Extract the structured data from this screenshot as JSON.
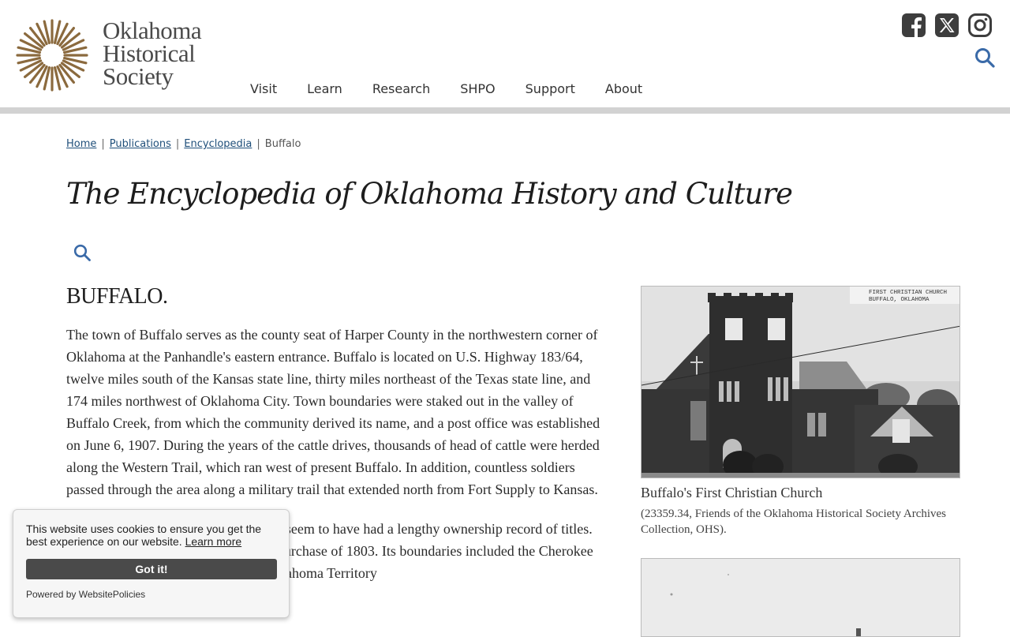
{
  "site": {
    "logo_lines": [
      "Oklahoma",
      "Historical",
      "Society"
    ],
    "nav": [
      "Visit",
      "Learn",
      "Research",
      "SHPO",
      "Support",
      "About"
    ],
    "social": [
      "facebook-icon",
      "x-icon",
      "instagram-icon"
    ],
    "accent": "#3a6aa8",
    "logo_color": "#8b6a3e"
  },
  "breadcrumb": {
    "home": "Home",
    "publications": "Publications",
    "encyclopedia": "Encyclopedia",
    "current": "Buffalo",
    "sep": "|"
  },
  "page": {
    "title": "The Encyclopedia of Oklahoma History and Culture"
  },
  "article": {
    "title": "BUFFALO.",
    "p1": "The town of Buffalo serves as the county seat of Harper County in the northwestern corner of Oklahoma at the Panhandle's eastern entrance. Buffalo is located on U.S. Highway 183/64, twelve miles south of the Kansas state line, thirty miles northeast of the Texas state line, and 174 miles northwest of Oklahoma City. Town boundaries were staked out in the valley of Buffalo Creek, from which the community derived its name, and a post office was established on June 6, 1907. During the years of the cattle drives, thousands of head of cattle were herded along the Western Trail, which ran west of present Buffalo. In addition, countless soldiers passed through the area along a military trail that extended north from Fort Supply to Kansas.",
    "p2": "The lands that became Harper County seem to have had a lengthy ownership record of titles. The area was a part of the Louisiana Purchase of 1803. Its boundaries included the Cherokee Outlet from 1835 until 1890 when Oklahoma Territory"
  },
  "figures": [
    {
      "caption": "Buffalo's First Christian Church",
      "credit": "(23359.34, Friends of the Oklahoma Historical Society Archives Collection, OHS).",
      "sign_lines": [
        "FIRST CHRISTIAN CHURCH",
        "BUFFALO, OKLAHOMA"
      ]
    }
  ],
  "cookie": {
    "message": "This website uses cookies to ensure you get the best experience on our website.",
    "learn_more": "Learn more",
    "button": "Got it!",
    "powered": "Powered by WebsitePolicies"
  }
}
